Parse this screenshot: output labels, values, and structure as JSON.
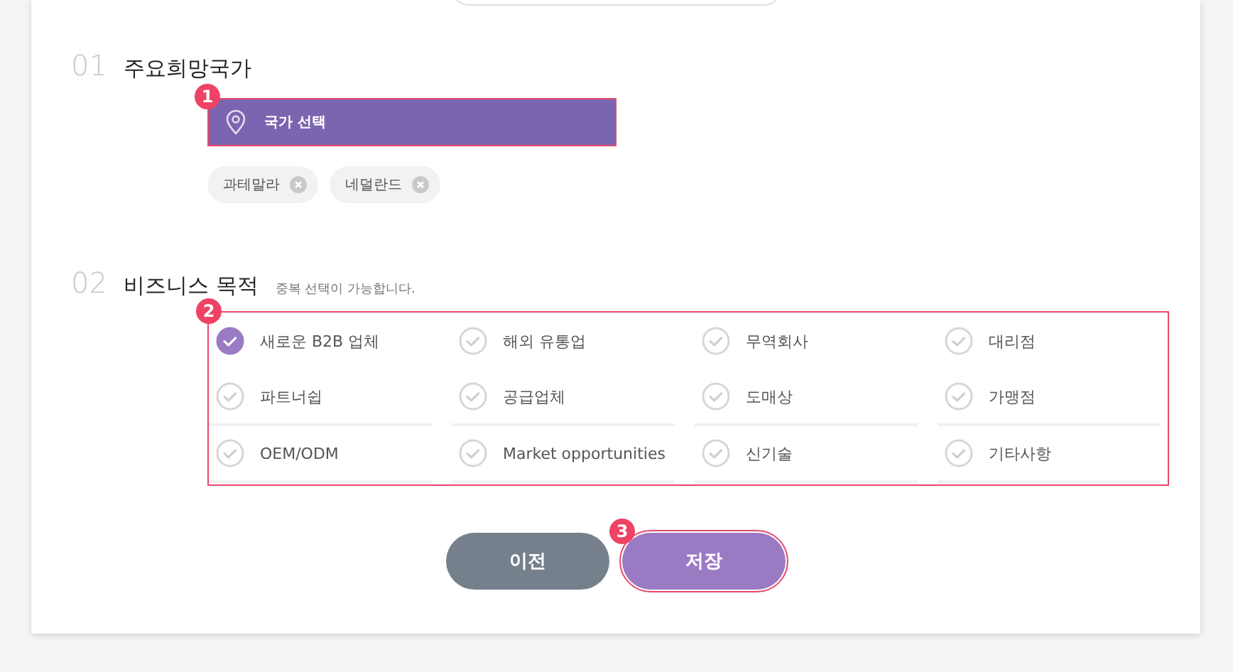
{
  "country_section": {
    "number": "01",
    "title": "주요희망국가",
    "select_label": "국가 선택",
    "marker": "1",
    "chips": [
      {
        "label": "과테말라"
      },
      {
        "label": "네덜란드"
      }
    ]
  },
  "purpose_section": {
    "number": "02",
    "title": "비즈니스 목적",
    "hint": "중복 선택이 가능합니다.",
    "marker": "2",
    "options": [
      {
        "label": "새로운 B2B 업체",
        "checked": true
      },
      {
        "label": "해외 유통업",
        "checked": false
      },
      {
        "label": "무역회사",
        "checked": false
      },
      {
        "label": "대리점",
        "checked": false
      },
      {
        "label": "파트너쉽",
        "checked": false
      },
      {
        "label": "공급업체",
        "checked": false
      },
      {
        "label": "도매상",
        "checked": false
      },
      {
        "label": "가맹점",
        "checked": false
      },
      {
        "label": "OEM/ODM",
        "checked": false
      },
      {
        "label": "Market opportunities",
        "checked": false
      },
      {
        "label": "신기술",
        "checked": false
      },
      {
        "label": "기타사항",
        "checked": false
      }
    ]
  },
  "buttons": [
    {
      "label": "이전",
      "kind": "secondary"
    },
    {
      "label": "저장",
      "kind": "primary",
      "marker": "3"
    }
  ]
}
